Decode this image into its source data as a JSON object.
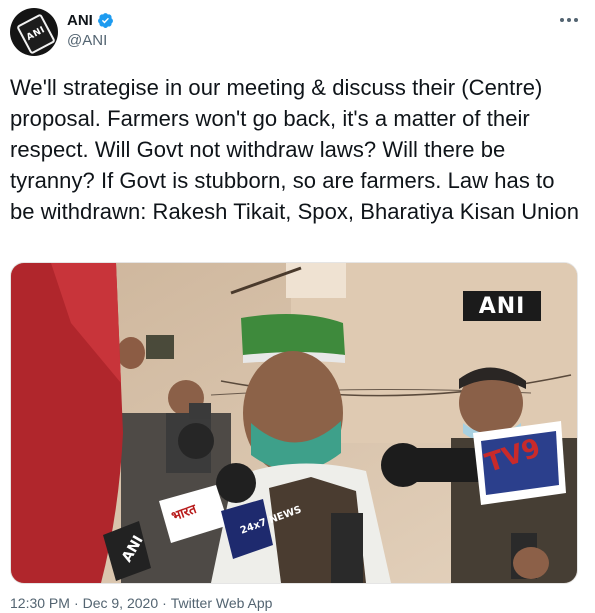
{
  "author": {
    "display_name": "ANI",
    "handle": "@ANI",
    "avatar_text": "ANI",
    "verified": true,
    "verified_icon": "verified-badge-icon",
    "verified_color": "#1d9bf0"
  },
  "more_icon": "more-horizontal-icon",
  "tweet": {
    "text": "We'll strategise in our meeting & discuss their (Centre) proposal. Farmers won't go back, it's a matter of their respect. Will Govt not withdraw laws? Will there be tyranny? If Govt is stubborn, so are farmers. Law has to be withdrawn: Rakesh Tikait, Spox, Bharatiya Kisan Union"
  },
  "media": {
    "watermark": "ANI",
    "mic_labels": {
      "tv9": "TV9",
      "news_24x7": "24x7 NEWS",
      "hindi": "भारत",
      "ani": "ANI"
    }
  },
  "meta": {
    "time": "12:30 PM",
    "separator": "·",
    "date": "Dec 9, 2020",
    "app": "Twitter Web App"
  },
  "colors": {
    "text_primary": "#0f1419",
    "text_secondary": "#536471"
  }
}
